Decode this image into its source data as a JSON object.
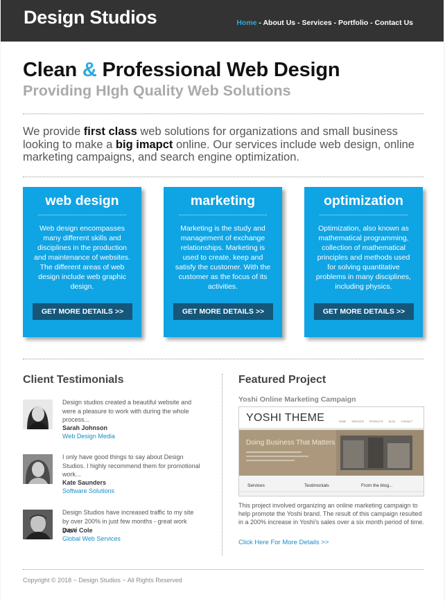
{
  "header": {
    "logo": "Design Studios",
    "nav": [
      {
        "label": "Home",
        "active": true
      },
      {
        "label": "About Us",
        "active": false
      },
      {
        "label": "Services",
        "active": false
      },
      {
        "label": "Portfolio",
        "active": false
      },
      {
        "label": "Contact Us",
        "active": false
      }
    ],
    "nav_separator": " - "
  },
  "hero": {
    "title_part1": "Clean ",
    "title_amp": "&",
    "title_part2": " Professional Web Design",
    "subtitle": "Providing HIgh Quality Web Solutions"
  },
  "intro": {
    "t1": "We provide ",
    "b1": "first class",
    "t2": " web solutions for organizations and small business looking to make a ",
    "b2": "big imapct",
    "t3": " online. Our services include web design, online marketing campaigns, and search engine optimization."
  },
  "services": [
    {
      "title": "web design",
      "description": "Web design encompasses many different skills and disciplines in the production and maintenance of websites. The different areas of web design include web graphic design.",
      "button": "GET MORE DETAILS >>"
    },
    {
      "title": "marketing",
      "description": "Marketing is the study and management of exchange relationships. Marketing is used to create, keep and satisfy the customer. With the customer as the focus of its activities.",
      "button": "GET MORE DETAILS >>"
    },
    {
      "title": "optimization",
      "description": "Optimization, also known as mathematical programming, collection of mathematical principles and methods used for solving quantitative problems in many disciplines, including physics.",
      "button": "GET MORE DETAILS >>"
    }
  ],
  "testimonials": {
    "heading": "Client Testimonials",
    "items": [
      {
        "text": "Design studios created a beautiful website and were a pleasure to work with during the whole process...",
        "name": "Sarah Johnson",
        "company": "Web Design Media"
      },
      {
        "text": "I only have good things to say about Design Studios. I highly recommend them for promotional work...",
        "name": "Kate Saunders",
        "company": "Software Solutions"
      },
      {
        "text": "Design Studios have increased traffic to my site by over 200% in just few months - great work guys!",
        "name": "Dave Cole",
        "company": "Global Web Services"
      }
    ]
  },
  "featured": {
    "heading": "Featured Project",
    "project_name": "Yoshi Online Marketing Campaign",
    "image": {
      "logo": "YOSHI THEME",
      "nav": [
        "HOME",
        "SERVICES",
        "PRODUCTS",
        "BLOG",
        "CONTACT"
      ],
      "banner_title": "Doing Business That Matters",
      "columns": [
        "Services",
        "Testimonials",
        "From the blog..."
      ]
    },
    "description": "This project involved organizing an online marketing campaign to help promote the Yoshi brand. The result of this campaign resulted in a 200% increase in Yoshi's sales over a six month period of time.",
    "link": "Click Here For More Details >>"
  },
  "footer": {
    "copyright": "Copyright © 2018 ~ Design Studios ~ All Rights Reserved"
  },
  "colors": {
    "header_bg": "#333333",
    "accent": "#29aae1",
    "service_box": "#0fa4e4",
    "service_button": "#15577a",
    "link": "#1b8bc8"
  }
}
